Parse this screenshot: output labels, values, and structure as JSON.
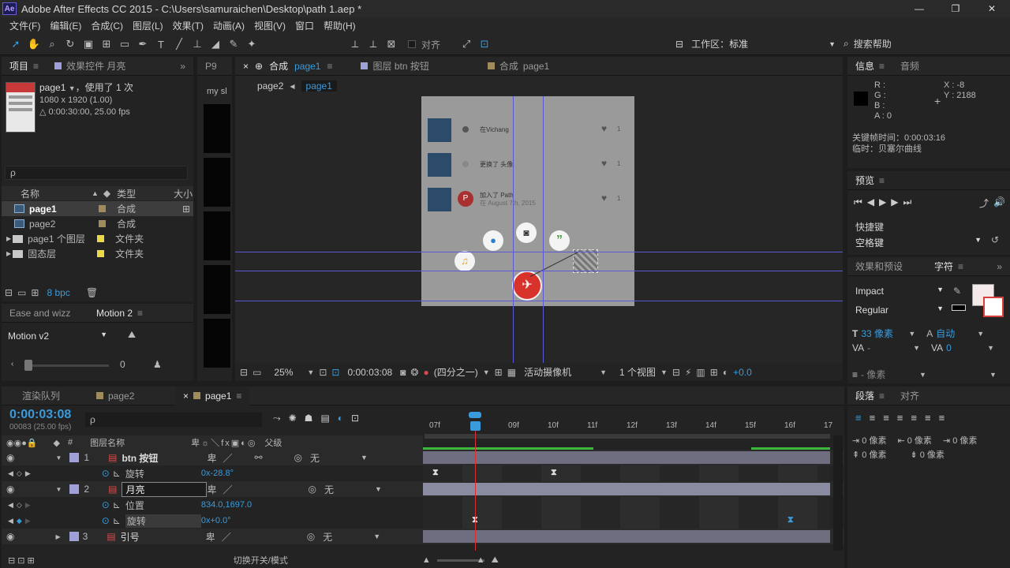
{
  "window": {
    "title": "Adobe After Effects CC 2015 - C:\\Users\\samuraichen\\Desktop\\path 1.aep *",
    "app_icon": "Ae",
    "controls": [
      "—",
      "❐",
      "✕"
    ]
  },
  "menu": [
    "文件(F)",
    "编辑(E)",
    "合成(C)",
    "图层(L)",
    "效果(T)",
    "动画(A)",
    "视图(V)",
    "窗口",
    "帮助(H)"
  ],
  "toolbar": {
    "align_label": "对齐",
    "workspace_label": "工作区：",
    "workspace_value": "标准",
    "search_help": "搜索帮助"
  },
  "project": {
    "tab": "项目",
    "tab2": "效果控件 月亮",
    "item_name": "page1",
    "used": "，使用了 1 次",
    "size": "1080 x 1920 (1.00)",
    "duration": "△ 0:00:30:00, 25.00 fps",
    "search_placeholder": "ρ",
    "col_name": "名称",
    "col_type": "类型",
    "col_size": "大小",
    "items": [
      {
        "name": "page1",
        "type": "合成",
        "color": "#a08c5a"
      },
      {
        "name": "page2",
        "type": "合成",
        "color": "#a08c5a"
      },
      {
        "name": "page1 个图层",
        "type": "文件夹",
        "color": "#e8d84a"
      },
      {
        "name": "固态层",
        "type": "文件夹",
        "color": "#e8d84a"
      }
    ],
    "bpc": "8 bpc"
  },
  "motion": {
    "tab1": "Ease and wizz",
    "tab2": "Motion 2",
    "preset": "Motion v2",
    "slider_value": "0"
  },
  "narrow_panel": {
    "tab": "P9",
    "label": "my sl"
  },
  "comp": {
    "tab_close": "×",
    "tab_lock": "🔓",
    "tab_label": "合成",
    "tab_name": "page1",
    "tab_layer": "图层 btn 按钮",
    "tab_comp2_label": "合成",
    "tab_comp2_name": "page1",
    "breadcrumb_1": "page2",
    "breadcrumb_2": "page1",
    "feed": [
      {
        "text": "在Vichang",
        "sub": "",
        "count": "1"
      },
      {
        "text": "更换了 头像",
        "sub": "",
        "count": "1"
      },
      {
        "text": "加入了 Path",
        "sub": "在 August 7th, 2015",
        "count": "1"
      }
    ],
    "footer": {
      "zoom": "25%",
      "time": "0:00:03:08",
      "resolution": "(四分之一)",
      "camera": "活动摄像机",
      "views": "1 个视图",
      "offset": "+0.0"
    }
  },
  "info": {
    "tab": "信息",
    "tab2": "音频",
    "r": "R :",
    "g": "G :",
    "b": "B :",
    "a": "A : 0",
    "x": "X : -8",
    "y": "Y : 2188",
    "keyframe_time": "关键帧时间：0:00:03:16",
    "interp": "临时：贝塞尔曲线"
  },
  "preview": {
    "tab": "预览",
    "shortcut_label": "快捷键",
    "shortcut_value": "空格键"
  },
  "character": {
    "tab1": "效果和预设",
    "tab2": "字符",
    "font": "Impact",
    "style": "Regular",
    "size": "33 像素",
    "leading": "自动",
    "tracking": "0",
    "kerning": "-",
    "stroke": "- 像素"
  },
  "paragraph": {
    "tab1": "段落",
    "tab2": "对齐",
    "indent1": "0 像素",
    "indent2": "0 像素",
    "indent3": "0 像素",
    "space1": "0 像素",
    "space2": "0 像素"
  },
  "timeline": {
    "tabs": [
      "渲染队列",
      "page2",
      "page1"
    ],
    "time": "0:00:03:08",
    "frames": "00083 (25.00 fps)",
    "col_layer": "图层名称",
    "col_parent": "父级",
    "ruler": [
      "07f",
      "09f",
      "10f",
      "11f",
      "12f",
      "13f",
      "14f",
      "15f",
      "16f",
      "17"
    ],
    "layers": [
      {
        "num": "1",
        "name": "btn 按钮",
        "parent": "无",
        "color": "#a0a0d8"
      },
      {
        "prop": "旋转",
        "value": "0x-28.8°"
      },
      {
        "num": "2",
        "name": "月亮",
        "parent": "无",
        "color": "#a0a0d8"
      },
      {
        "prop": "位置",
        "value": "834.0,1697.0"
      },
      {
        "prop": "旋转",
        "value": "0x+0.0°"
      },
      {
        "num": "3",
        "name": "引号",
        "parent": "无",
        "color": "#a0a0d8"
      }
    ],
    "footer_label": "切换开关/模式"
  }
}
